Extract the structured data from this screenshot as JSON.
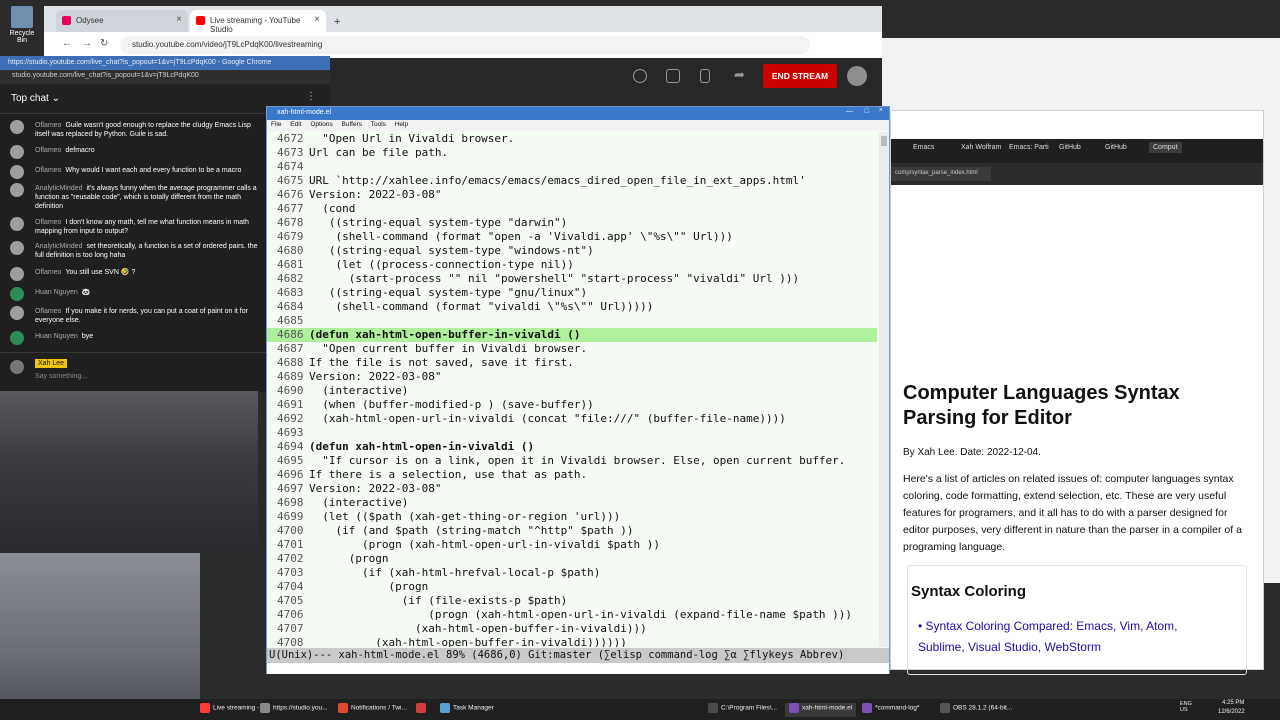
{
  "desktop": {
    "recycle_bin_label": "Recycle Bin"
  },
  "yt_browser": {
    "tabs": [
      {
        "label": "Odysee",
        "color": "#e50054"
      },
      {
        "label": "Live streaming - YouTube Studio",
        "color": "#ff0000"
      }
    ],
    "new_tab": "+",
    "url": "studio.youtube.com/video/jT9LcPdqK00/livestreaming",
    "end_stream_label": "END STREAM"
  },
  "chat": {
    "window_title": "https://studio.youtube.com/live_chat?is_popout=1&v=jT9LcPdqK00 - Google Chrome",
    "url": "studio.youtube.com/live_chat?is_popout=1&v=jT9LcPdqK00",
    "header": "Top chat",
    "messages": [
      {
        "author": "Oflameo",
        "text": "Guile wasn't good enough to replace the cludgy Emacs Lisp itself was replaced by Python. Guile is sad."
      },
      {
        "author": "Oflameo",
        "text": "defmacro"
      },
      {
        "author": "Oflameo",
        "text": "Why would I want each and every function to be a macro"
      },
      {
        "author": "AnalyticMinded",
        "text": "it's always funny when the average programmer calls a function as \"reusable code\", which is totally different from the math definition"
      },
      {
        "author": "Oflameo",
        "text": "I don't know any math, tell me what function means in math mapping from input to output?"
      },
      {
        "author": "AnalyticMinded",
        "text": "set theoretically, a function is a set of ordered pairs. the full definition is too long haha"
      },
      {
        "author": "Oflameo",
        "text": "You still use SVN 🤣 ?"
      },
      {
        "author": "Huan Nguyen",
        "text": "🐼"
      },
      {
        "author": "Oflameo",
        "text": "If you make it for nerds, you can put a coat of paint on it for everyone else."
      },
      {
        "author": "Huan Nguyen",
        "text": "bye"
      }
    ],
    "input_user": "Xah Lee",
    "input_placeholder": "Say something..."
  },
  "emacs": {
    "window_title": "xah-html-mode.el",
    "menu": [
      "File",
      "Edit",
      "Options",
      "Buffers",
      "Tools",
      "Help"
    ],
    "lines": [
      {
        "n": "4672",
        "t": "  \"Open Url in Vivaldi browser."
      },
      {
        "n": "4673",
        "t": "Url can be file path."
      },
      {
        "n": "4674",
        "t": ""
      },
      {
        "n": "4675",
        "t": "URL `http://xahlee.info/emacs/emacs/emacs_dired_open_file_in_ext_apps.html'"
      },
      {
        "n": "4676",
        "t": "Version: 2022-03-08\""
      },
      {
        "n": "4677",
        "t": "  (cond"
      },
      {
        "n": "4678",
        "t": "   ((string-equal system-type \"darwin\")"
      },
      {
        "n": "4679",
        "t": "    (shell-command (format \"open -a 'Vivaldi.app' \\\"%s\\\"\" Url)))"
      },
      {
        "n": "4680",
        "t": "   ((string-equal system-type \"windows-nt\")"
      },
      {
        "n": "4681",
        "t": "    (let ((process-connection-type nil))"
      },
      {
        "n": "4682",
        "t": "      (start-process \"\" nil \"powershell\" \"start-process\" \"vivaldi\" Url )))"
      },
      {
        "n": "4683",
        "t": "   ((string-equal system-type \"gnu/linux\")"
      },
      {
        "n": "4684",
        "t": "    (shell-command (format \"vivaldi \\\"%s\\\"\" Url)))))"
      },
      {
        "n": "4685",
        "t": ""
      },
      {
        "n": "4686",
        "t": "(defun xah-html-open-buffer-in-vivaldi ()"
      },
      {
        "n": "4687",
        "t": "  \"Open current buffer in Vivaldi browser."
      },
      {
        "n": "4688",
        "t": "If the file is not saved, save it first."
      },
      {
        "n": "4689",
        "t": "Version: 2022-03-08\""
      },
      {
        "n": "4690",
        "t": "  (interactive)"
      },
      {
        "n": "4691",
        "t": "  (when (buffer-modified-p ) (save-buffer))"
      },
      {
        "n": "4692",
        "t": "  (xah-html-open-url-in-vivaldi (concat \"file:///\" (buffer-file-name))))"
      },
      {
        "n": "4693",
        "t": ""
      },
      {
        "n": "4694",
        "t": "(defun xah-html-open-in-vivaldi ()"
      },
      {
        "n": "4695",
        "t": "  \"If cursor is on a link, open it in Vivaldi browser. Else, open current buffer."
      },
      {
        "n": "4696",
        "t": "If there is a selection, use that as path."
      },
      {
        "n": "4697",
        "t": "Version: 2022-03-08\""
      },
      {
        "n": "4698",
        "t": "  (interactive)"
      },
      {
        "n": "4699",
        "t": "  (let (($path (xah-get-thing-or-region 'url)))"
      },
      {
        "n": "4700",
        "t": "    (if (and $path (string-match \"^http\" $path ))"
      },
      {
        "n": "4701",
        "t": "        (progn (xah-html-open-url-in-vivaldi $path ))"
      },
      {
        "n": "4702",
        "t": "      (progn"
      },
      {
        "n": "4703",
        "t": "        (if (xah-html-hrefval-local-p $path)"
      },
      {
        "n": "4704",
        "t": "            (progn"
      },
      {
        "n": "4705",
        "t": "              (if (file-exists-p $path)"
      },
      {
        "n": "4706",
        "t": "                  (progn (xah-html-open-url-in-vivaldi (expand-file-name $path )))"
      },
      {
        "n": "4707",
        "t": "                (xah-html-open-buffer-in-vivaldi)))"
      },
      {
        "n": "4708",
        "t": "          (xah-html-open-buffer-in-vivaldi))))))"
      }
    ],
    "highlight_line": "4686",
    "modeline": "U(Unix)--- xah-html-mode.el 89% (4686,0) Git:master (∑elisp command-log ∑α ∑flykeys Abbrev)"
  },
  "right_browser": {
    "tabs": [
      "Emacs",
      "Xah Wolfram",
      "Emacs: Parti",
      "GitHub",
      "GitHub",
      "Comput"
    ],
    "url": "comp/syntax_parse_index.html",
    "title": "Computer Languages Syntax Parsing for Editor",
    "byline": "By Xah Lee. Date: 2022-12-04.",
    "intro": "Here's a list of articles on related issues of: computer languages syntax coloring, code formatting, extend selection, etc. These are very useful features for programers, and it all has to do with a parser designed for editor purposes, very different in nature than the parser in a compiler of a programing language.",
    "section_heading": "Syntax Coloring",
    "section_link": "Syntax Coloring Compared: Emacs, Vim, Atom, Sublime, Visual Studio, WebStorm"
  },
  "taskbar": {
    "items": [
      "Live streaming - Y...",
      "https://studio.you...",
      "Notifications / Twi...",
      "Task Manager",
      "C:\\Program Files\\...",
      "xah-html-mode.el",
      "*command-log*",
      "OBS 28.1.2 (64-bit..."
    ],
    "lang": "ENG US",
    "time": "4:25 PM",
    "date": "12/6/2022"
  }
}
